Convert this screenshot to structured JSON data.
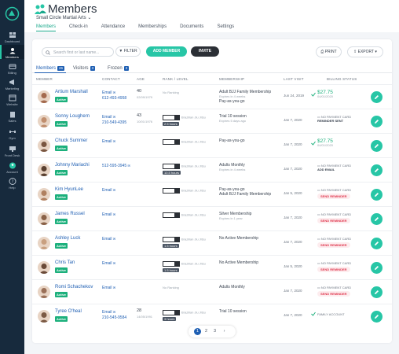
{
  "sidebar": {
    "items": [
      {
        "label": "Dashboard",
        "icon": "dashboard-icon"
      },
      {
        "label": "Members",
        "icon": "members-icon"
      },
      {
        "label": "Billing",
        "icon": "billing-icon"
      },
      {
        "label": "Marketing",
        "icon": "marketing-icon"
      },
      {
        "label": "Website",
        "icon": "website-icon"
      },
      {
        "label": "Sales",
        "icon": "sales-icon"
      },
      {
        "label": "Gym",
        "icon": "gym-icon"
      },
      {
        "label": "Front Desk",
        "icon": "front-desk-icon"
      },
      {
        "label": "Account",
        "icon": "account-icon"
      },
      {
        "label": "Help",
        "icon": "help-icon"
      }
    ]
  },
  "header": {
    "title": "Members",
    "org": "Small Circle Martial Arts",
    "tabs": [
      "Members",
      "Check-in",
      "Attendance",
      "Memberships",
      "Documents",
      "Settings"
    ]
  },
  "toolbar": {
    "search_placeholder": "Search first or last name...",
    "filter": "FILTER",
    "add_member": "ADD MEMBER",
    "invite": "INVITE",
    "print": "PRINT",
    "export": "EXPORT"
  },
  "subtabs": [
    {
      "label": "Members",
      "count": "26"
    },
    {
      "label": "Visitors",
      "count": "3"
    },
    {
      "label": "Frozen",
      "count": "2"
    }
  ],
  "columns": [
    "MEMBER",
    "CONTACT",
    "AGE",
    "RANK / LEVEL",
    "MEMBERSHIP",
    "LAST VISIT",
    "BILLING STATUS"
  ],
  "status": "Active",
  "rows": [
    {
      "name": "Artium Marshall",
      "email": "Email",
      "phone": "612-493-4958",
      "age": "40",
      "dob": "02/09/1979",
      "rank": "No Ranking",
      "hours": "",
      "membership": "Adult BJJ Family Membership",
      "membership_note": "Expires in 4 weeks",
      "membership2": "Pay-as-you-go",
      "visit": "Jun 24, 2019",
      "billing_type": "paid",
      "billing_amt": "$27.75",
      "billing_date": "04/01/2020",
      "billing_extra": ""
    },
    {
      "name": "Sonny Loughern",
      "email": "Email",
      "phone": "210-549-4395",
      "age": "43",
      "dob": "10/01/1976",
      "rank": "Brazilian Jiu Jitsu",
      "hours": "2.5 hours",
      "membership": "Trial 10 session",
      "membership_note": "Expires 5 days ago",
      "membership2": "",
      "visit": "Jan 7, 2020",
      "billing_type": "nocard",
      "billing_amt": "NO PAYMENT CARD",
      "billing_date": "",
      "billing_extra": "REMINDER SENT"
    },
    {
      "name": "Chuck Summer",
      "email": "Email",
      "phone": "",
      "age": "",
      "dob": "",
      "rank": "Brazilian Jiu Jitsu",
      "hours": "",
      "membership": "Pay-as-you-go",
      "membership_note": "",
      "membership2": "",
      "visit": "Jan 7, 2020",
      "billing_type": "paid",
      "billing_amt": "$27.75",
      "billing_date": "04/01/2020",
      "billing_extra": ""
    },
    {
      "name": "Johnny Mariachi",
      "email": "512-595-3945",
      "phone": "",
      "age": "",
      "dob": "",
      "rank": "Brazilian Jiu Jitsu",
      "hours": "10.5 hours",
      "membership": "Adults Monthly",
      "membership_note": "Expires in 4 weeks",
      "membership2": "",
      "visit": "Jan 7, 2020",
      "billing_type": "nocard",
      "billing_amt": "NO PAYMENT CARD",
      "billing_date": "",
      "billing_extra": "ADD EMAIL"
    },
    {
      "name": "Kim HyunLee",
      "email": "Email",
      "phone": "",
      "age": "",
      "dob": "",
      "rank": "Brazilian Jiu Jitsu",
      "hours": "",
      "membership": "Pay-as-you-go",
      "membership_note": "",
      "membership2": "Adult BJJ Family Membership",
      "visit": "Jan 5, 2020",
      "billing_type": "nocard",
      "billing_amt": "NO PAYMENT CARD",
      "billing_date": "",
      "billing_extra": "SEND REMINDER"
    },
    {
      "name": "James Russel",
      "email": "Email",
      "phone": "",
      "age": "",
      "dob": "",
      "rank": "Brazilian Jiu Jitsu",
      "hours": "",
      "membership": "Silver Membership",
      "membership_note": "Expires in 1 year",
      "membership2": "",
      "visit": "Jan 7, 2020",
      "billing_type": "nocard",
      "billing_amt": "NO PAYMENT CARD",
      "billing_date": "",
      "billing_extra": "SEND REMINDER"
    },
    {
      "name": "Ashley Luck",
      "email": "Email",
      "phone": "",
      "age": "",
      "dob": "",
      "rank": "Brazilian Jiu Jitsu",
      "hours": "1.5 hours",
      "membership": "No Active Membership",
      "membership_note": "",
      "membership2": "",
      "visit": "Jan 7, 2020",
      "billing_type": "nocard",
      "billing_amt": "NO PAYMENT CARD",
      "billing_date": "",
      "billing_extra": "SEND REMINDER"
    },
    {
      "name": "Chris Tan",
      "email": "Email",
      "phone": "",
      "age": "",
      "dob": "",
      "rank": "Brazilian Jiu Jitsu",
      "hours": "1.5 hours",
      "membership": "No Active Membership",
      "membership_note": "",
      "membership2": "",
      "visit": "Jan 5, 2020",
      "billing_type": "nocard",
      "billing_amt": "NO PAYMENT CARD",
      "billing_date": "",
      "billing_extra": "SEND REMINDER"
    },
    {
      "name": "Romi Schachekov",
      "email": "Email",
      "phone": "",
      "age": "",
      "dob": "",
      "rank": "No Ranking",
      "hours": "",
      "membership": "Adults Monthly",
      "membership_note": "",
      "membership2": "",
      "visit": "Jan 7, 2020",
      "billing_type": "nocard",
      "billing_amt": "NO PAYMENT CARD",
      "billing_date": "",
      "billing_extra": "SEND REMINDER"
    },
    {
      "name": "Tyree O'heal",
      "email": "Email",
      "phone": "210-545-9584",
      "age": "28",
      "dob": "14/05/1991",
      "rank": "Brazilian Jiu Jitsu",
      "hours": "3 hours",
      "membership": "Trial 10 session",
      "membership_note": "",
      "membership2": "",
      "visit": "Jan 7, 2020",
      "billing_type": "family",
      "billing_amt": "FAMILY ACCOUNT",
      "billing_date": "",
      "billing_extra": ""
    }
  ],
  "pager": [
    "1",
    "2",
    "3",
    "›"
  ],
  "colors": {
    "accent": "#27c6a6",
    "link": "#1f5fb3",
    "sidebar": "#172a3d",
    "danger": "#e0384f"
  }
}
